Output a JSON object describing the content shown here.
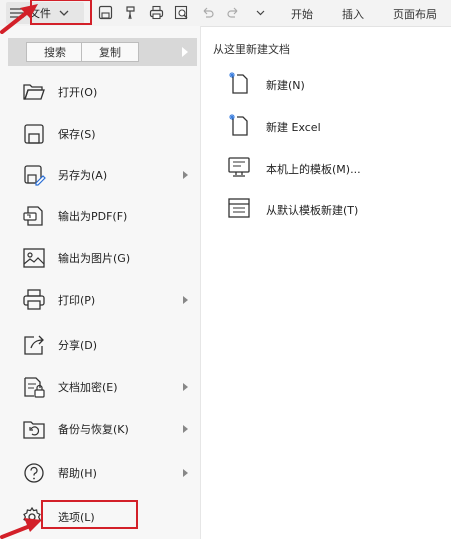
{
  "toolbar": {
    "file_label": "文件",
    "tabs": [
      "开始",
      "插入",
      "页面布局"
    ]
  },
  "menu": {
    "top_buttons": [
      "搜索",
      "复制"
    ],
    "items": [
      {
        "label": "打开(O)",
        "icon": "folder-open-icon",
        "has_submenu": false
      },
      {
        "label": "保存(S)",
        "icon": "save-icon",
        "has_submenu": false
      },
      {
        "label": "另存为(A)",
        "icon": "save-as-icon",
        "has_submenu": true
      },
      {
        "label": "输出为PDF(F)",
        "icon": "pdf-export-icon",
        "has_submenu": false
      },
      {
        "label": "输出为图片(G)",
        "icon": "image-export-icon",
        "has_submenu": false
      },
      {
        "label": "打印(P)",
        "icon": "printer-icon",
        "has_submenu": true
      },
      {
        "label": "分享(D)",
        "icon": "share-icon",
        "has_submenu": false
      },
      {
        "label": "文档加密(E)",
        "icon": "document-lock-icon",
        "has_submenu": true
      },
      {
        "label": "备份与恢复(K)",
        "icon": "backup-restore-icon",
        "has_submenu": true
      },
      {
        "label": "帮助(H)",
        "icon": "help-icon",
        "has_submenu": true
      },
      {
        "label": "选项(L)",
        "icon": "gear-icon",
        "has_submenu": false
      }
    ]
  },
  "right_panel": {
    "title": "从这里新建文档",
    "items": [
      {
        "label": "新建(N)",
        "icon": "new-document-icon"
      },
      {
        "label": "新建 Excel",
        "icon": "new-excel-icon"
      },
      {
        "label": "本机上的模板(M)...",
        "icon": "local-template-icon"
      },
      {
        "label": "从默认模板新建(T)",
        "icon": "default-template-icon"
      }
    ]
  },
  "colors": {
    "highlight_red": "#d32029",
    "panel_bg": "#f7f7f7",
    "toolbar_bg": "#f3f3f3"
  }
}
